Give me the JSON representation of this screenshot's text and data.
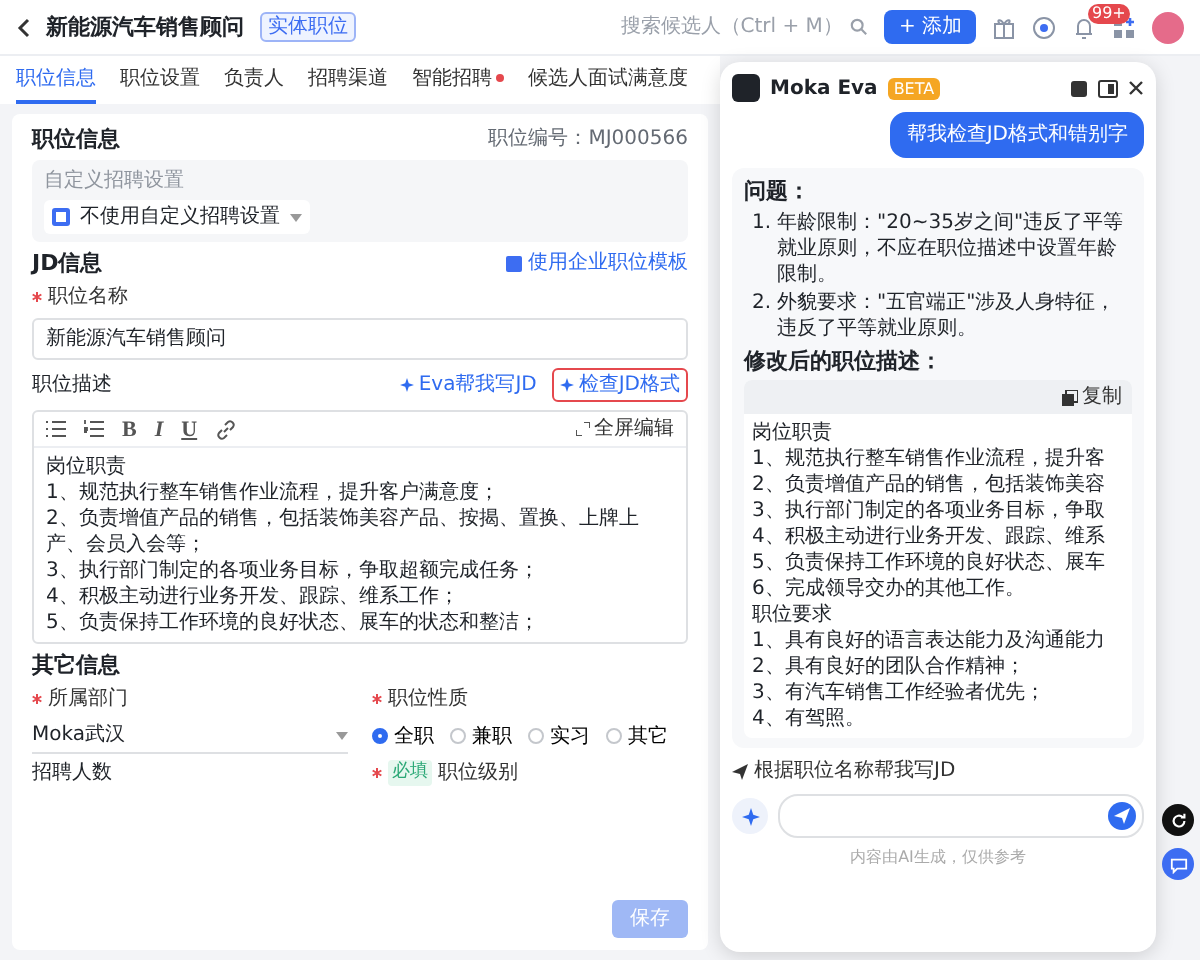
{
  "header": {
    "title": "新能源汽车销售顾问",
    "tag": "实体职位",
    "search_placeholder": "搜索候选人（Ctrl + M）",
    "add_button": "+ 添加",
    "badge": "99+"
  },
  "tabs": [
    {
      "label": "职位信息",
      "selected": true,
      "dot": false
    },
    {
      "label": "职位设置",
      "selected": false,
      "dot": false
    },
    {
      "label": "负责人",
      "selected": false,
      "dot": false
    },
    {
      "label": "招聘渠道",
      "selected": false,
      "dot": false
    },
    {
      "label": "智能招聘",
      "selected": false,
      "dot": true
    },
    {
      "label": "候选人面试满意度",
      "selected": false,
      "dot": false
    }
  ],
  "job_info": {
    "title": "职位信息",
    "job_id": "职位编号：MJ000566",
    "custom_label": "自定义招聘设置",
    "custom_value": "不使用自定义招聘设置"
  },
  "jd": {
    "title": "JD信息",
    "template_link": "使用企业职位模板",
    "name_label": "职位名称",
    "name_required": true,
    "name_value": "新能源汽车销售顾问",
    "desc_label": "职位描述",
    "actions": [
      {
        "label": "Eva帮我写JD",
        "selected": false
      },
      {
        "label": "检查JD格式",
        "selected": true
      }
    ],
    "toolbar": [
      {
        "kind": "bullets"
      },
      {
        "kind": "numbers"
      },
      {
        "kind": "text",
        "label": "B"
      },
      {
        "kind": "text",
        "label": "I"
      },
      {
        "kind": "text",
        "label": "U"
      },
      {
        "kind": "link"
      }
    ],
    "fullscreen": "全屏编辑",
    "lines": [
      "岗位职责",
      "1、规范执行整车销售作业流程，提升客户满意度；",
      "2、负责增值产品的销售，包括装饰美容产品、按揭、置换、上牌上产、会员入会等；",
      "3、执行部门制定的各项业务目标，争取超额完成任务；",
      "4、积极主动进行业务开发、跟踪、维系工作；",
      "5、负责保持工作环境的良好状态、展车的状态和整洁；"
    ]
  },
  "other": {
    "title": "其它信息",
    "dept_label": "所属部门",
    "dept_required": true,
    "dept_value": "Moka武汉",
    "type_label": "职位性质",
    "type_required": true,
    "types": [
      {
        "label": "全职",
        "selected": true
      },
      {
        "label": "兼职",
        "selected": false
      },
      {
        "label": "实习",
        "selected": false
      },
      {
        "label": "其它",
        "selected": false
      }
    ],
    "count_label": "招聘人数",
    "level_required": true,
    "level_tag": "必填",
    "level_label": "职位级别",
    "save": "保存"
  },
  "chat": {
    "name": "Moka Eva",
    "badge": "BETA",
    "user_message": "帮我检查JD格式和错别字",
    "problem_title": "问题：",
    "problems": [
      {
        "marker": "1.",
        "text": "年龄限制：\"20~35岁之间\"违反了平等就业原则，不应在职位描述中设置年龄限制。"
      },
      {
        "marker": "2.",
        "text": "外貌要求：\"五官端正\"涉及人身特征，违反了平等就业原则。"
      }
    ],
    "revised_title": "修改后的职位描述：",
    "copy": "复制",
    "revised_lines": [
      "岗位职责",
      "1、规范执行整车销售作业流程，提升客",
      "2、负责增值产品的销售，包括装饰美容",
      "3、执行部门制定的各项业务目标，争取",
      "4、积极主动进行业务开发、跟踪、维系",
      "5、负责保持工作环境的良好状态、展车",
      "6、完成领导交办的其他工作。",
      "职位要求",
      "1、具有良好的语言表达能力及沟通能力",
      "2、具有良好的团队合作精神；",
      "3、有汽车销售工作经验者优先；",
      "4、有驾照。"
    ],
    "suggestion": "根据职位名称帮我写JD",
    "footnote": "内容由AI生成，仅供参考"
  }
}
